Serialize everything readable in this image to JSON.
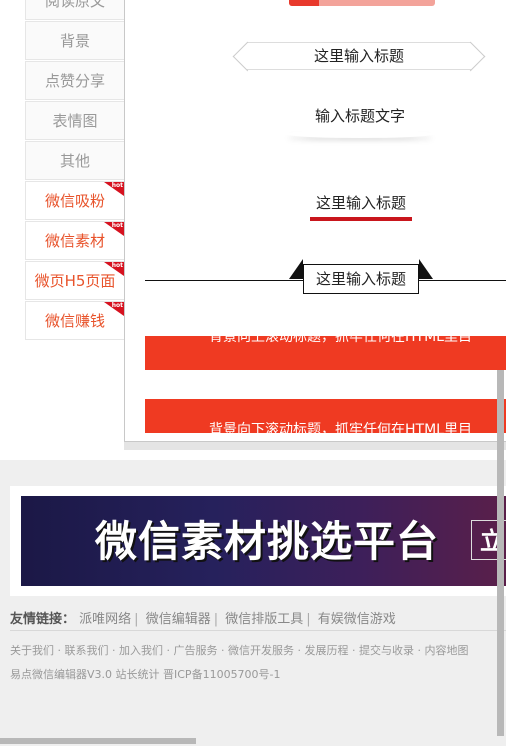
{
  "sidebar": {
    "items": [
      {
        "label": "阅读原文",
        "hot": false
      },
      {
        "label": "背景",
        "hot": false
      },
      {
        "label": "点赞分享",
        "hot": false
      },
      {
        "label": "表情图",
        "hot": false
      },
      {
        "label": "其他",
        "hot": false
      },
      {
        "label": "微信吸粉",
        "hot": true
      },
      {
        "label": "微信素材",
        "hot": true
      },
      {
        "label": "微页H5页面",
        "hot": true
      },
      {
        "label": "微信赚钱",
        "hot": true
      }
    ],
    "badge_text": "hot"
  },
  "templates": {
    "ribbon_title": "这里输入标题",
    "shadow_title": "输入标题文字",
    "underline_title": "这里输入标题",
    "box_title": "这里输入标题",
    "banner1_text": "背景向上滚动标题，抓牢任何在HTML里目",
    "banner2_text": "背景向下滚动标题，抓牢任何在HTML里目"
  },
  "ad": {
    "title": "微信素材挑选平台",
    "button": "立"
  },
  "footer": {
    "links_label": "友情链接：",
    "links": [
      "派唯网络",
      "微信编辑器",
      "微信排版工具",
      "有娱微信游戏"
    ],
    "nav": [
      "关于我们",
      "联系我们",
      "加入我们",
      "广告服务",
      "微信开发服务",
      "发展历程",
      "提交与收录",
      "内容地图"
    ],
    "copyright": "易点微信编辑器V3.0 站长统计 晋ICP备11005700号-1"
  },
  "colors": {
    "accent_red": "#ef3a22",
    "hot_text": "#e8532b",
    "underline_red": "#c9161d"
  }
}
